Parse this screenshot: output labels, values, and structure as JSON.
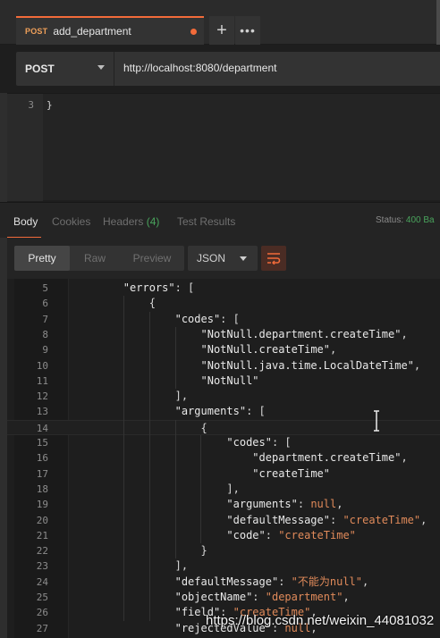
{
  "tab": {
    "method": "POST",
    "title": "add_department",
    "add_label": "+",
    "more_label": "•••"
  },
  "request": {
    "method": "POST",
    "url": "http://localhost:8080/department",
    "line_number": "3",
    "line_text": "}"
  },
  "response_tabs": {
    "body": "Body",
    "cookies": "Cookies",
    "headers": "Headers",
    "headers_count": "(4)",
    "test_results": "Test Results",
    "status_label": "Status:",
    "status_value": "400 Ba"
  },
  "format": {
    "pretty": "Pretty",
    "raw": "Raw",
    "preview": "Preview",
    "type": "JSON"
  },
  "code_lines": [
    {
      "n": "5",
      "t": "        \"errors\": ["
    },
    {
      "n": "6",
      "t": "            {"
    },
    {
      "n": "7",
      "t": "                \"codes\": ["
    },
    {
      "n": "8",
      "t": "                    \"NotNull.department.createTime\","
    },
    {
      "n": "9",
      "t": "                    \"NotNull.createTime\","
    },
    {
      "n": "10",
      "t": "                    \"NotNull.java.time.LocalDateTime\","
    },
    {
      "n": "11",
      "t": "                    \"NotNull\""
    },
    {
      "n": "12",
      "t": "                ],"
    },
    {
      "n": "13",
      "t": "                \"arguments\": ["
    },
    {
      "n": "14",
      "t": "                    {"
    },
    {
      "n": "15",
      "t": "                        \"codes\": ["
    },
    {
      "n": "16",
      "t": "                            \"department.createTime\","
    },
    {
      "n": "17",
      "t": "                            \"createTime\""
    },
    {
      "n": "18",
      "t": "                        ],"
    },
    {
      "n": "19",
      "t": "                        \"arguments\": null,"
    },
    {
      "n": "20",
      "t": "                        \"defaultMessage\": \"createTime\","
    },
    {
      "n": "21",
      "t": "                        \"code\": \"createTime\""
    },
    {
      "n": "22",
      "t": "                    }"
    },
    {
      "n": "23",
      "t": "                ],"
    },
    {
      "n": "24",
      "t": "                \"defaultMessage\": \"不能为null\","
    },
    {
      "n": "25",
      "t": "                \"objectName\": \"department\","
    },
    {
      "n": "26",
      "t": "                \"field\": \"createTime\","
    },
    {
      "n": "27",
      "t": "                \"rejectedValue\": null,"
    }
  ],
  "watermark": "https://blog.csdn.net/weixin_44081032",
  "colors": {
    "accent": "#f26b3a",
    "status_ok": "#49a35c",
    "string_value": "#e08a5a"
  }
}
